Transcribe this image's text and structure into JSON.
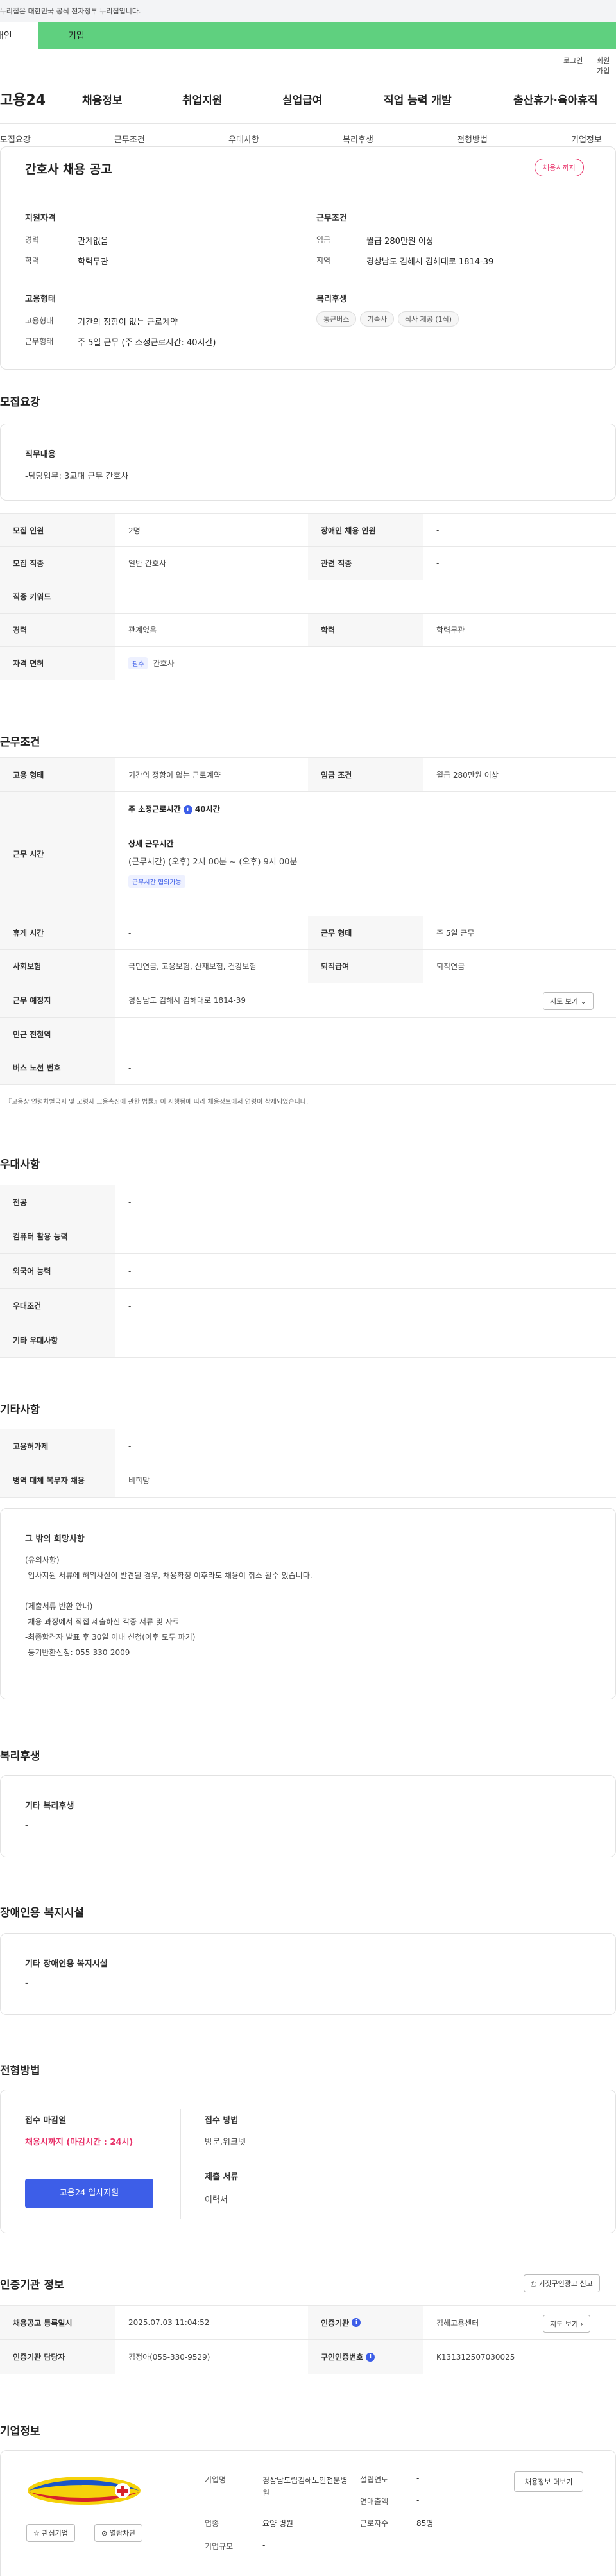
{
  "gov_banner": "이 누리집은 대한민국 공식 전자정부 누리집입니다.",
  "tabs": {
    "personal": "개인",
    "company": "기업"
  },
  "util": {
    "login": "로그인",
    "join": "회원가입"
  },
  "header": {
    "logo": "고용24",
    "gnb": [
      "채용정보",
      "취업지원",
      "실업급여",
      "직업 능력 개발",
      "출산휴가·육아휴직"
    ]
  },
  "subnav": [
    "모집요강",
    "근무조건",
    "우대사항",
    "복리후생",
    "전형방법",
    "기업정보"
  ],
  "summary": {
    "title": "간호사 채용 공고",
    "status_badge": "채용시까지",
    "qual_heading": "지원자격",
    "qual": [
      {
        "k": "경력",
        "v": "관계없음"
      },
      {
        "k": "학력",
        "v": "학력무관"
      }
    ],
    "emp_heading": "고용형태",
    "emp": [
      {
        "k": "고용형태",
        "v": "기간의 정함이 없는 근로계약"
      },
      {
        "k": "근무형태",
        "v": "주 5일 근무 (주 소정근로시간: 40시간)"
      }
    ],
    "cond_heading": "근무조건",
    "cond": [
      {
        "k": "임금",
        "v": "월급 280만원 이상"
      },
      {
        "k": "지역",
        "v": "경상남도 김해시 김해대로 1814-39"
      }
    ],
    "welfare_heading": "복리후생",
    "welfare_chips": [
      "통근버스",
      "기숙사",
      "식사 제공 (1식)"
    ]
  },
  "recruit": {
    "section_title": "모집요강",
    "duty_heading": "직무내용",
    "duty_text": "-담당업무: 3교대 근무 간호사",
    "rows": [
      {
        "k1": "모집 인원",
        "v1": "2명",
        "k2": "장애인 채용 인원",
        "v2": "-"
      },
      {
        "k1": "모집 직종",
        "v1": "일반 간호사",
        "k2": "관련 직종",
        "v2": "-"
      },
      {
        "k1": "직종 키워드",
        "v1": "-"
      },
      {
        "k1": "경력",
        "v1": "관계없음",
        "k2": "학력",
        "v2": "학력무관"
      }
    ],
    "license_label": "자격 면허",
    "license_tag": "필수",
    "license_value": "간호사"
  },
  "work": {
    "section_title": "근무조건",
    "type_label": "고용 형태",
    "type_value": "기간의 정함이 없는 근로계약",
    "wage_label": "임금 조건",
    "wage_value": "월급 280만원 이상",
    "time_label": "근무 시간",
    "hours_line": "주 소정근로시간",
    "hours_value": "40시간",
    "detail_heading": "상세 근무시간",
    "detail_text": "(근무시간) (오후) 2시 00분 ~ (오후) 9시 00분",
    "consult_tag": "근무시간 협의가능",
    "rows": [
      {
        "k1": "휴게 시간",
        "v1": "-",
        "k2": "근무 형태",
        "v2": "주 5일 근무"
      },
      {
        "k1": "사회보험",
        "v1": "국민연금, 고용보험, 산재보험, 건강보험",
        "k2": "퇴직급여",
        "v2": "퇴직연금"
      }
    ],
    "place_label": "근무 예정지",
    "place_value": "경상남도 김해시 김해대로 1814-39",
    "map_button": "지도 보기",
    "station_label": "인근 전철역",
    "station_value": "-",
    "bus_label": "버스 노선 번호",
    "bus_value": "-",
    "footnote": "『고용상 연령차별금지 및 고령자 고용촉진에 관한 법률』이 시행됨에 따라 채용정보에서 연령이 삭제되었습니다."
  },
  "prefer": {
    "section_title": "우대사항",
    "rows": [
      {
        "k": "전공",
        "v": "-"
      },
      {
        "k": "컴퓨터 활용 능력",
        "v": "-"
      },
      {
        "k": "외국어 능력",
        "v": "-"
      },
      {
        "k": "우대조건",
        "v": "-"
      },
      {
        "k": "기타 우대사항",
        "v": "-"
      }
    ]
  },
  "etc": {
    "section_title": "기타사항",
    "rows": [
      {
        "k": "고용허가제",
        "v": "-"
      },
      {
        "k": "병역 대체 복무자 채용",
        "v": "비희망"
      }
    ],
    "hope_heading": "그 밖의 희망사항",
    "hope_text": "(유의사항)\n-입사지원 서류에 허위사실이 발견될 경우, 채용확정 이후라도 채용이 취소 될수 있습니다.\n\n(제출서류 반환 안내)\n-채용 과정에서 직접 제출하신 각종 서류 및 자료\n-최종합격자 발표 후 30일 이내 신청(이후 모두 파기)\n-등기반환신청: 055-330-2009"
  },
  "welfare": {
    "section_title": "복리후생",
    "heading": "기타 복리후생",
    "value": "-"
  },
  "disability": {
    "section_title": "장애인용 복지시설",
    "heading": "기타 장애인용 복지시설",
    "value": "-"
  },
  "screening": {
    "section_title": "전형방법",
    "deadline_heading": "접수 마감일",
    "deadline_value": "채용시까지 (마감시간 : 24시)",
    "apply_button": "고용24 입사지원",
    "method_heading": "접수 방법",
    "method_value": "방문,워크넷",
    "docs_heading": "제출 서류",
    "docs_value": "이력서"
  },
  "agency": {
    "section_title": "인증기관 정보",
    "report_button": "거짓구인광고 신고",
    "rows": [
      {
        "k1": "채용공고 등록일시",
        "v1": "2025.07.03 11:04:52",
        "k2": "인증기관",
        "v2": "김해고용센터"
      },
      {
        "k1": "인증기관 담당자",
        "v1": "김정아(055-330-9529)",
        "k2": "구인인증번호",
        "v2": "K131312507030025"
      }
    ],
    "map_button": "지도 보기"
  },
  "company": {
    "section_title": "기업정보",
    "fav_button": "관심기업",
    "block_button": "열람차단",
    "info_button": "채용정보 더보기",
    "left": [
      {
        "k": "기업명",
        "v": "경상남도립김해노인전문병원"
      },
      {
        "k": "업종",
        "v": "요양 병원"
      },
      {
        "k": "기업규모",
        "v": "-"
      }
    ],
    "right": [
      {
        "k": "설립연도",
        "v": "-"
      },
      {
        "k": "연매출액",
        "v": "-"
      },
      {
        "k": "근로자수",
        "v": "85명"
      }
    ]
  },
  "colors": {
    "accent_green": "#5fd07f",
    "brand_blue": "#3d5ee8",
    "alert_red": "#e8336a"
  }
}
